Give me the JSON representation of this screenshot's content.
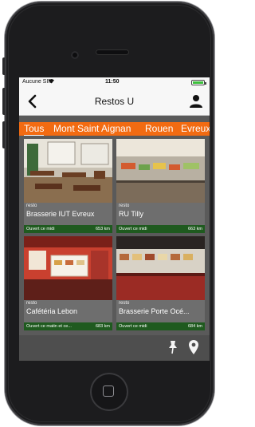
{
  "status": {
    "carrier": "Aucune SIM",
    "time": "11:50"
  },
  "nav": {
    "title": "Restos U"
  },
  "filters": [
    {
      "label": "Tous",
      "active": true
    },
    {
      "label": "Mont Saint Aignan",
      "active": false
    },
    {
      "label": "Rouen",
      "active": false
    },
    {
      "label": "Evreux",
      "active": false
    }
  ],
  "cards": [
    {
      "type": "resto",
      "name": "Brasserie IUT Evreux",
      "hours": "Ouvert ce midi",
      "distance": "653 km"
    },
    {
      "type": "resto",
      "name": "RU Tilly",
      "hours": "Ouvert ce midi",
      "distance": "663 km"
    },
    {
      "type": "resto",
      "name": "Cafétéria Lebon",
      "hours": "Ouvert ce matin et ce...",
      "distance": "683 km"
    },
    {
      "type": "resto",
      "name": "Brasserie Porte Océ...",
      "hours": "Ouvert ce midi",
      "distance": "684 km"
    }
  ],
  "colors": {
    "accent": "#f26b12",
    "footer_green": "#1f5a1f",
    "toolbar": "#4e4e4e"
  },
  "icons": {
    "back": "chevron-left-icon",
    "profile": "user-icon",
    "pin": "pushpin-icon",
    "map": "map-marker-icon"
  }
}
